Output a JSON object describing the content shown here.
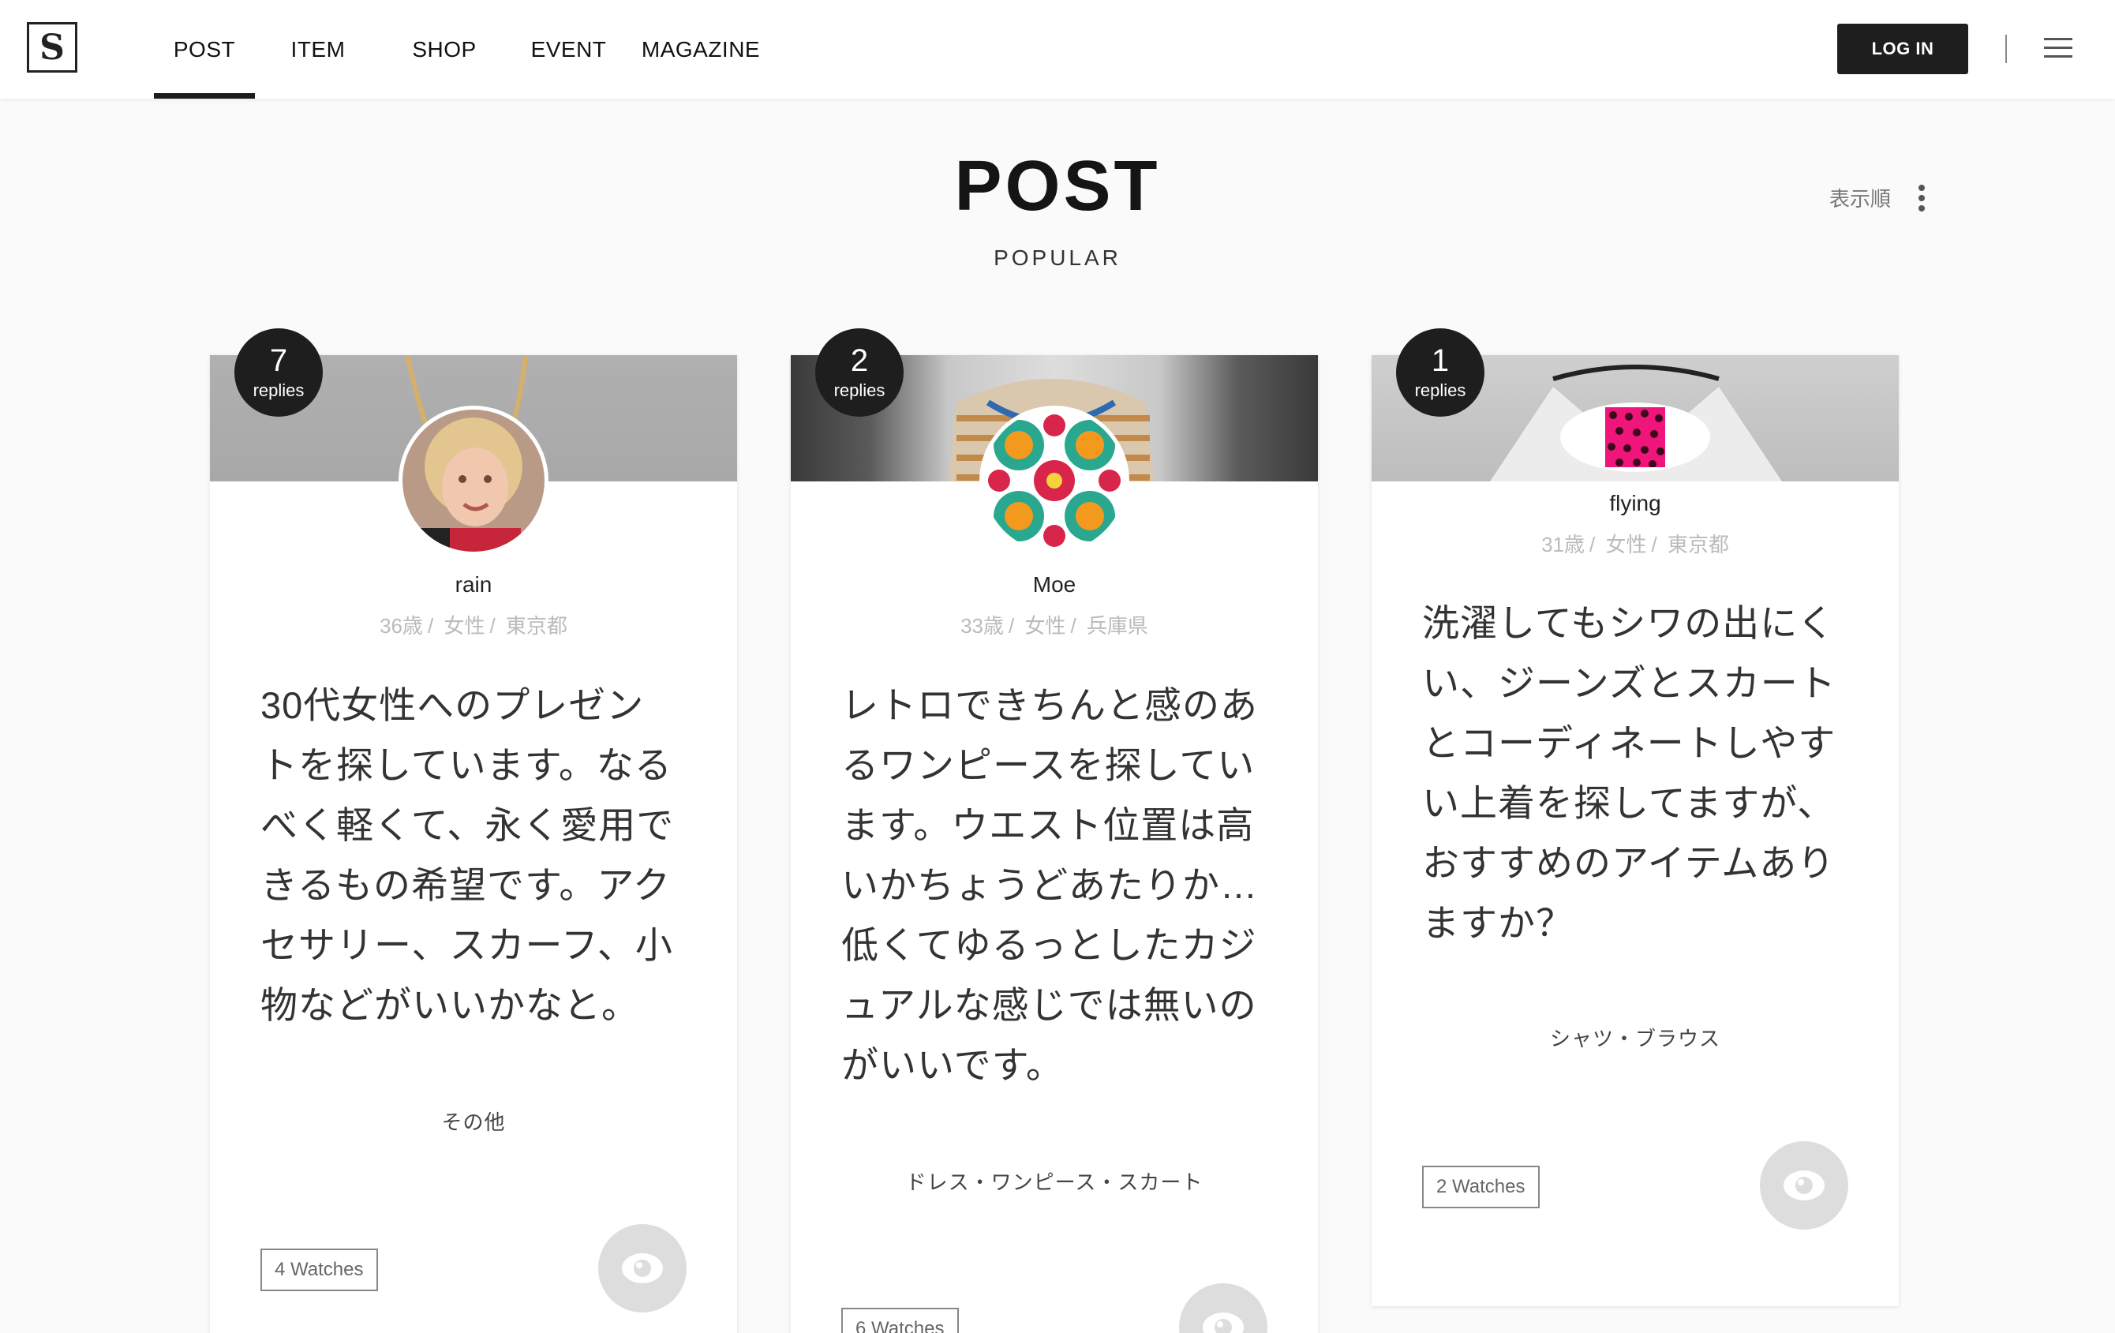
{
  "header": {
    "logo": "S",
    "nav": [
      "POST",
      "ITEM",
      "SHOP",
      "EVENT",
      "MAGAZINE"
    ],
    "login": "LOG IN"
  },
  "page": {
    "title": "POST",
    "subtitle": "POPULAR",
    "sort_label": "表示順"
  },
  "posts": [
    {
      "replies": "7",
      "replies_label": "replies",
      "user": "rain",
      "age": "36歳",
      "gender": "女性",
      "location": "東京都",
      "text": [
        "30代女性へのプレゼン",
        "トを探しています。なる",
        "べく軽くて、永く愛用で",
        "きるもの希望です。アク",
        "セサリー、スカーフ、小",
        "物などがいいかなと。"
      ],
      "category": "その他",
      "watches": "4 Watches"
    },
    {
      "replies": "2",
      "replies_label": "replies",
      "user": "Moe",
      "age": "33歳",
      "gender": "女性",
      "location": "兵庫県",
      "text": [
        "レトロできちんと感のあ",
        "るワンピースを探してい",
        "ます。ウエスト位置は高",
        "いかちょうどあたりか…",
        "低くてゆるっとしたカジ",
        "ュアルな感じでは無いの",
        "がいいです。"
      ],
      "category": "ドレス・ワンピース・スカート",
      "watches": "6 Watches"
    },
    {
      "replies": "1",
      "replies_label": "replies",
      "user": "flying",
      "age": "31歳",
      "gender": "女性",
      "location": "東京都",
      "text": [
        "洗濯してもシワの出にく",
        "い、ジーンズとスカート",
        "とコーディネートしやす",
        "い上着を探してますが、",
        "おすすめのアイテムあり",
        "ますか？"
      ],
      "category": "シャツ・ブラウス",
      "watches": "2 Watches"
    }
  ],
  "icons": {
    "menu": "hamburger-menu-icon",
    "sort": "kebab-more-icon",
    "watch": "eye-icon"
  },
  "colors": {
    "dark": "#1e1e1e",
    "badge": "#1e1e1e",
    "muted": "#bbbbbb",
    "eye_bg": "#dddddd"
  }
}
